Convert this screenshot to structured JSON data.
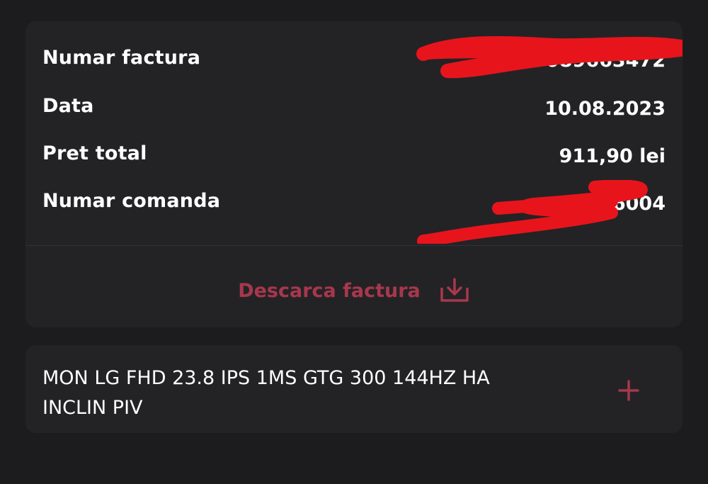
{
  "invoice": {
    "rows": [
      {
        "label": "Numar factura",
        "value": "...X-089663472"
      },
      {
        "label": "Data",
        "value": "10.08.2023"
      },
      {
        "label": "Pret total",
        "value": "911,90 lei"
      },
      {
        "label": "Numar comanda",
        "value": "...6004"
      }
    ],
    "download": {
      "label": "Descarca factura",
      "icon": "download-icon"
    }
  },
  "product": {
    "name": "MON LG FHD 23.8 IPS 1MS GTG 300 144HZ HA INCLIN PIV",
    "expand_icon": "plus-icon"
  },
  "colors": {
    "background": "#1c1c1e",
    "card": "#232325",
    "accent": "#a8374d",
    "redaction": "#e8141c"
  }
}
